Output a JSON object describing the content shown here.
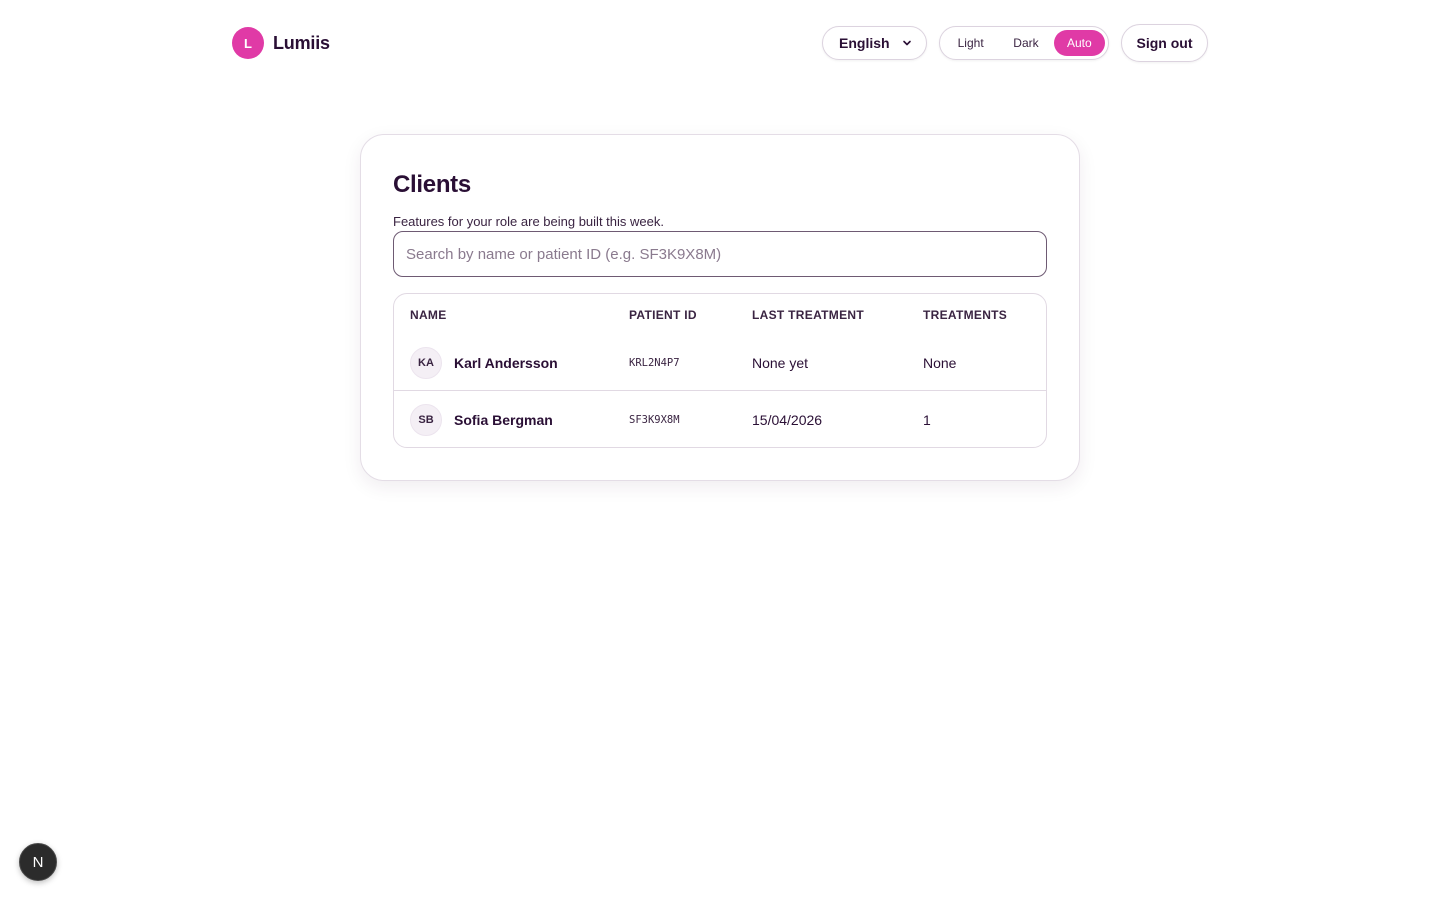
{
  "brand": {
    "initial": "L",
    "name": "Lumiis",
    "accent_color": "#e03aa6"
  },
  "header": {
    "language": {
      "selected": "English",
      "icon": "chevron-down-icon"
    },
    "theme": {
      "options": [
        "Light",
        "Dark",
        "Auto"
      ],
      "selected": "Auto"
    },
    "sign_out_label": "Sign out"
  },
  "main": {
    "title": "Clients",
    "subtitle": "Features for your role are being built this week.",
    "search": {
      "placeholder": "Search by name or patient ID (e.g. SF3K9X8M)",
      "value": ""
    },
    "table": {
      "columns": [
        "NAME",
        "PATIENT ID",
        "LAST TREATMENT",
        "TREATMENTS"
      ],
      "rows": [
        {
          "initials": "KA",
          "name": "Karl Andersson",
          "patient_id": "KRL2N4P7",
          "last_treatment": "None yet",
          "treatments": "None"
        },
        {
          "initials": "SB",
          "name": "Sofia Bergman",
          "patient_id": "SF3K9X8M",
          "last_treatment": "15/04/2026",
          "treatments": "1"
        }
      ]
    }
  },
  "dev_badge": {
    "letter": "N"
  }
}
